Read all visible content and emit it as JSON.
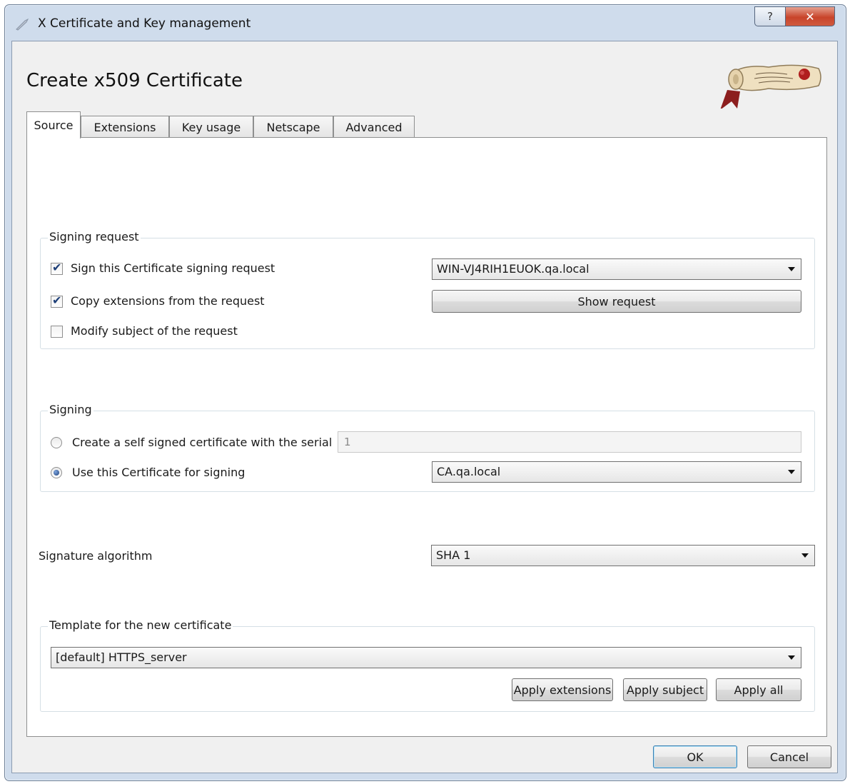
{
  "window": {
    "title": "X Certificate and Key management",
    "help_glyph": "?",
    "close_glyph": "✕"
  },
  "page": {
    "title": "Create x509 Certificate"
  },
  "tabs": [
    {
      "label": "Source",
      "active": true
    },
    {
      "label": "Extensions",
      "active": false
    },
    {
      "label": "Key usage",
      "active": false
    },
    {
      "label": "Netscape",
      "active": false
    },
    {
      "label": "Advanced",
      "active": false
    }
  ],
  "signing_request": {
    "group_label": "Signing request",
    "sign_csr": {
      "label": "Sign this Certificate signing request",
      "checked": true
    },
    "csr_select": {
      "value": "WIN-VJ4RIH1EUOK.qa.local"
    },
    "copy_extensions": {
      "label": "Copy extensions from the request",
      "checked": true
    },
    "show_request_button": "Show request",
    "modify_subject": {
      "label": "Modify subject of the request",
      "checked": false
    }
  },
  "signing": {
    "group_label": "Signing",
    "self_signed": {
      "label": "Create a self signed certificate with the serial",
      "selected": false
    },
    "serial_value": "1",
    "use_certificate": {
      "label": "Use this Certificate for signing",
      "selected": true
    },
    "ca_select": {
      "value": "CA.qa.local"
    }
  },
  "signature_algorithm": {
    "label": "Signature algorithm",
    "value": "SHA 1"
  },
  "template": {
    "group_label": "Template for the new certificate",
    "value": "[default] HTTPS_server",
    "apply_extensions": "Apply extensions",
    "apply_subject": "Apply subject",
    "apply_all": "Apply all"
  },
  "dialog_buttons": {
    "ok": "OK",
    "cancel": "Cancel"
  },
  "check_glyph": "✔"
}
